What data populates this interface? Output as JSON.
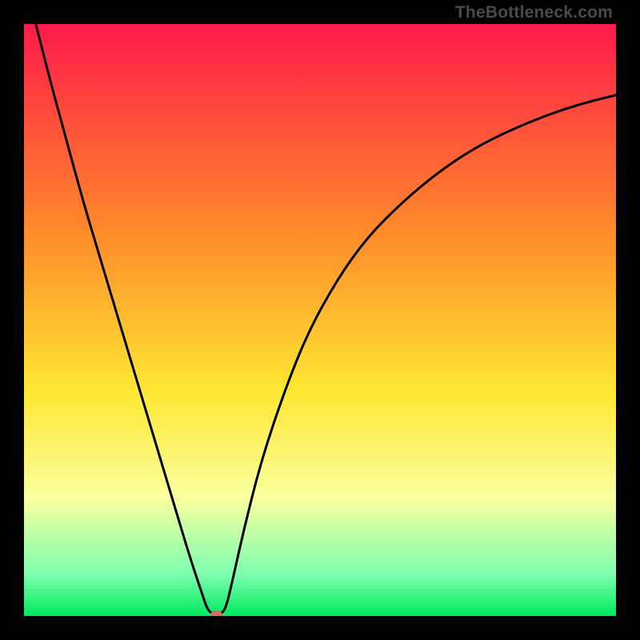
{
  "watermark": "TheBottleneck.com",
  "colors": {
    "red_top": "#ff1a4b",
    "orange": "#ff8a2a",
    "yellow": "#ffe733",
    "pale_yellow": "#faff9e",
    "light_green": "#7dffb0",
    "green_bottom": "#00e85e",
    "frame": "#000000",
    "curve": "#000000",
    "marker": "#d46a6a"
  },
  "chart_data": {
    "type": "line",
    "title": "",
    "xlabel": "",
    "ylabel": "",
    "xlim": [
      0,
      100
    ],
    "ylim": [
      0,
      100
    ],
    "curve": [
      {
        "x": 2,
        "y": 100
      },
      {
        "x": 4,
        "y": 92
      },
      {
        "x": 7,
        "y": 81
      },
      {
        "x": 10,
        "y": 70
      },
      {
        "x": 13,
        "y": 60
      },
      {
        "x": 16,
        "y": 50
      },
      {
        "x": 19,
        "y": 40
      },
      {
        "x": 22,
        "y": 30
      },
      {
        "x": 25,
        "y": 20
      },
      {
        "x": 28,
        "y": 10
      },
      {
        "x": 30,
        "y": 4
      },
      {
        "x": 31,
        "y": 1
      },
      {
        "x": 32,
        "y": 0.3
      },
      {
        "x": 33,
        "y": 0.3
      },
      {
        "x": 34,
        "y": 1
      },
      {
        "x": 35,
        "y": 5
      },
      {
        "x": 37,
        "y": 14
      },
      {
        "x": 40,
        "y": 26
      },
      {
        "x": 44,
        "y": 38
      },
      {
        "x": 48,
        "y": 48
      },
      {
        "x": 53,
        "y": 57
      },
      {
        "x": 58,
        "y": 64
      },
      {
        "x": 64,
        "y": 70
      },
      {
        "x": 70,
        "y": 75
      },
      {
        "x": 76,
        "y": 79
      },
      {
        "x": 82,
        "y": 82
      },
      {
        "x": 88,
        "y": 84.5
      },
      {
        "x": 94,
        "y": 86.5
      },
      {
        "x": 100,
        "y": 88
      }
    ],
    "marker": {
      "x": 32.5,
      "y": 0.3
    },
    "gradient_stops": [
      {
        "offset": 0.0,
        "color_key": "red_top"
      },
      {
        "offset": 0.35,
        "color_key": "orange"
      },
      {
        "offset": 0.62,
        "color_key": "yellow"
      },
      {
        "offset": 0.8,
        "color_key": "pale_yellow"
      },
      {
        "offset": 0.93,
        "color_key": "light_green"
      },
      {
        "offset": 1.0,
        "color_key": "green_bottom"
      }
    ]
  }
}
